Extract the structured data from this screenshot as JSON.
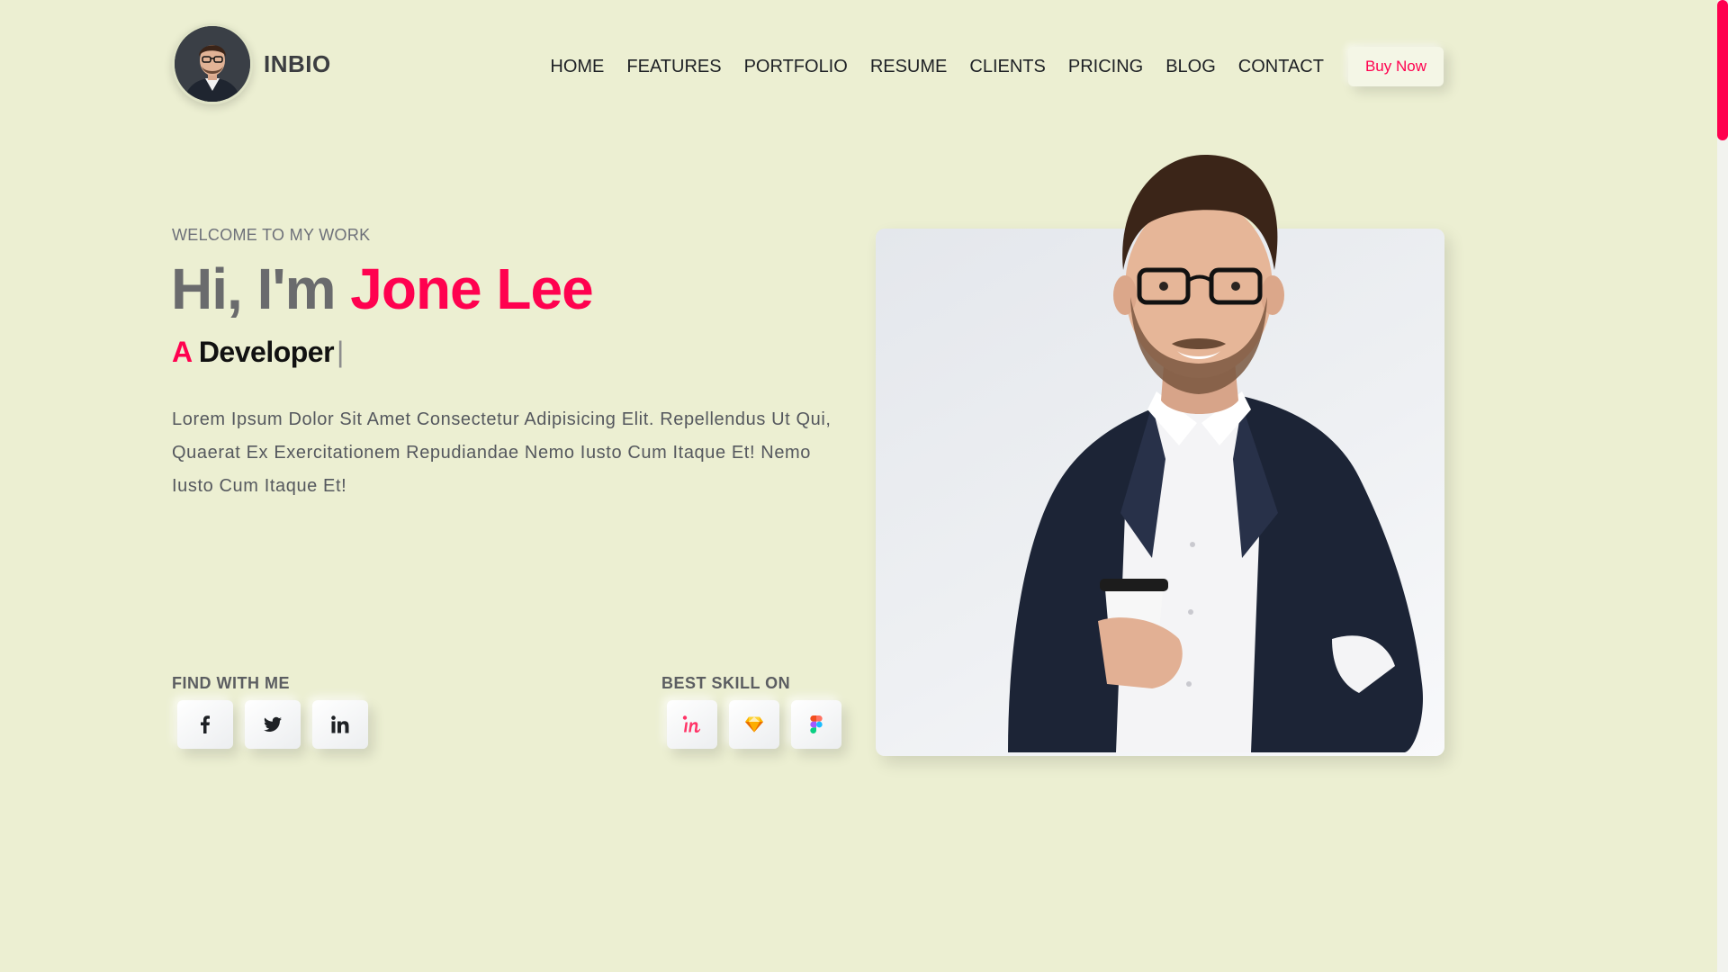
{
  "brand": {
    "name": "INBIO",
    "avatar_icon": "profile-avatar"
  },
  "nav": {
    "items": [
      "HOME",
      "FEATURES",
      "PORTFOLIO",
      "RESUME",
      "CLIENTS",
      "PRICING",
      "BLOG",
      "CONTACT"
    ],
    "cta_label": "Buy Now"
  },
  "hero": {
    "welcome": "WELCOME TO MY WORK",
    "greeting": "Hi, I'm",
    "name": "Jone Lee",
    "role_prefix": "A",
    "role": "Developer",
    "cursor": "|",
    "description": "Lorem Ipsum Dolor Sit Amet Consectetur Adipisicing Elit. Repellendus Ut Qui, Quaerat Ex Exercitationem Repudiandae Nemo Iusto Cum Itaque Et! Nemo Iusto Cum Itaque Et!"
  },
  "social": {
    "label": "FIND WITH ME",
    "icons": [
      "facebook-icon",
      "twitter-icon",
      "linkedin-icon"
    ]
  },
  "skills": {
    "label": "BEST SKILL ON",
    "icons": [
      "invision-icon",
      "sketch-icon",
      "figma-icon"
    ]
  },
  "colors": {
    "background": "#ecefd2",
    "accent": "#ff014f",
    "heading_gray": "#6a6b6d",
    "text": "#55585e"
  },
  "scroll": {
    "position": 0
  }
}
